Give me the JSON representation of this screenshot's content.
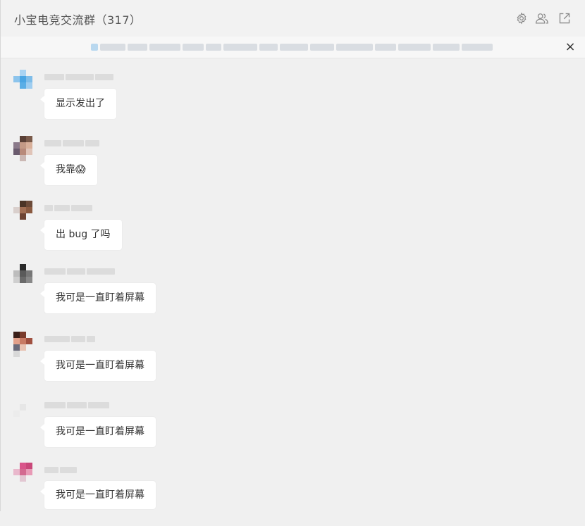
{
  "window": {
    "title": "小宝电竞交流群（317）"
  },
  "header_icons": [
    "gear-icon",
    "group-members-icon",
    "pop-out-icon"
  ],
  "notice": {
    "close_label": "×"
  },
  "messages": [
    {
      "text": "显示发出了"
    },
    {
      "text": "我靠😱"
    },
    {
      "text": "出 bug 了吗"
    },
    {
      "text": "我可是一直盯着屏幕"
    },
    {
      "text": "我可是一直盯着屏幕"
    },
    {
      "text": "我可是一直盯着屏幕"
    },
    {
      "text": "我可是一直盯着屏幕"
    }
  ]
}
